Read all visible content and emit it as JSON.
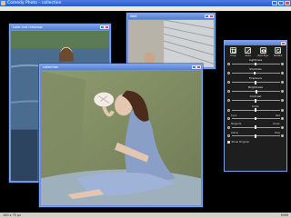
{
  "app": {
    "title": "Comedy Photo – collection"
  },
  "windows": {
    "back_left": {
      "title": "Lake and meadow"
    },
    "back_right": {
      "title": "Wall"
    },
    "front": {
      "title": "collection"
    }
  },
  "panel": {
    "tools": [
      {
        "label": "Crop",
        "icon": "crop-icon"
      },
      {
        "label": "Auto",
        "icon": "auto-fix-icon"
      },
      {
        "label": "Red-Eye",
        "icon": "red-eye-icon"
      },
      {
        "label": "Rotate",
        "icon": "rotate-icon"
      }
    ],
    "sliders": [
      {
        "label": "Lightness",
        "value": 0.5
      },
      {
        "label": "Shadows",
        "value": 0.48
      },
      {
        "label": "Exposure",
        "value": 0.5
      },
      {
        "label": "Brightness",
        "value": 0.52
      },
      {
        "label": "Contrast",
        "value": 0.5
      },
      {
        "label": "Color",
        "value": 0.5
      }
    ],
    "color_sliders": [
      {
        "left": "Cyan",
        "right": "Red",
        "value": 0.5
      },
      {
        "left": "Magenta",
        "right": "Green",
        "value": 0.5
      },
      {
        "left": "Yellow",
        "right": "Blue",
        "value": 0.5
      }
    ],
    "show_original_label": "Show Original"
  },
  "status": {
    "left": "100 x 75 px",
    "right": "NUM"
  }
}
